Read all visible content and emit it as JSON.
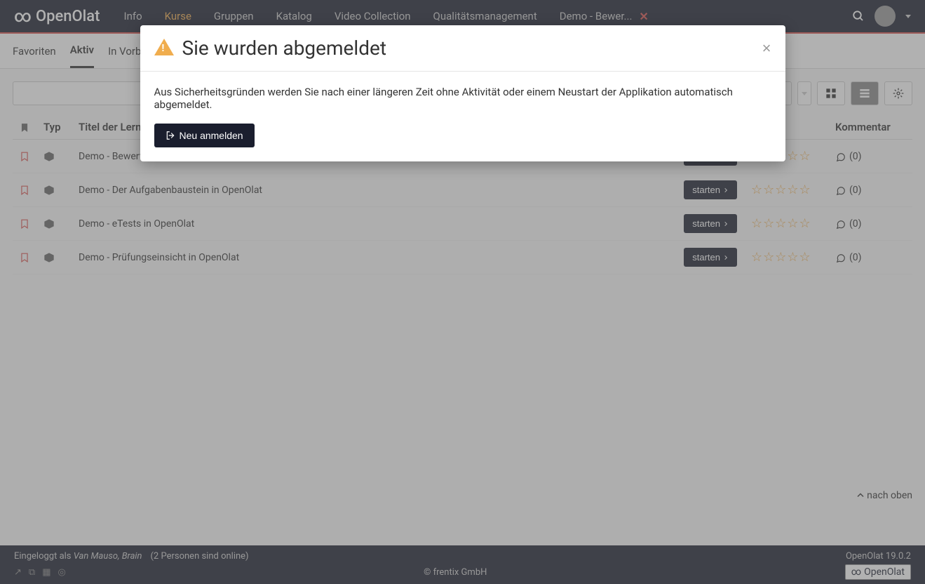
{
  "brand": "OpenOlat",
  "nav": {
    "items": [
      "Info",
      "Kurse",
      "Gruppen",
      "Katalog",
      "Video Collection",
      "Qualitätsmanagement",
      "Demo - Bewer..."
    ],
    "active_index": 1
  },
  "subnav": {
    "items": [
      "Favoriten",
      "Aktiv",
      "In Vorbe"
    ],
    "active_index": 1
  },
  "table": {
    "headers": {
      "bookmark": "",
      "type": "Typ",
      "title": "Titel der Lernres",
      "rating": "",
      "comment": "Kommentar"
    },
    "action_label": "starten",
    "rows": [
      {
        "title": "Demo - Bewertbare Bausteine in OpenOlat",
        "comments": 0
      },
      {
        "title": "Demo - Der Aufgabenbaustein in OpenOlat",
        "comments": 0
      },
      {
        "title": "Demo - eTests in OpenOlat",
        "comments": 0
      },
      {
        "title": "Demo - Prüfungseinsicht in OpenOlat",
        "comments": 0
      }
    ]
  },
  "back_to_top": "nach oben",
  "footer": {
    "logged_in_prefix": "Eingeloggt als ",
    "user": "Van Mauso, Brain",
    "online": "(2 Personen sind online)",
    "version": "OpenOlat 19.0.2",
    "copyright": "© frentix GmbH",
    "brand": "OpenOlat"
  },
  "modal": {
    "title": "Sie wurden abgemeldet",
    "body": "Aus Sicherheitsgründen werden Sie nach einer längeren Zeit ohne Aktivität oder einem Neustart der Applikation automatisch abgemeldet.",
    "button": "Neu anmelden"
  }
}
